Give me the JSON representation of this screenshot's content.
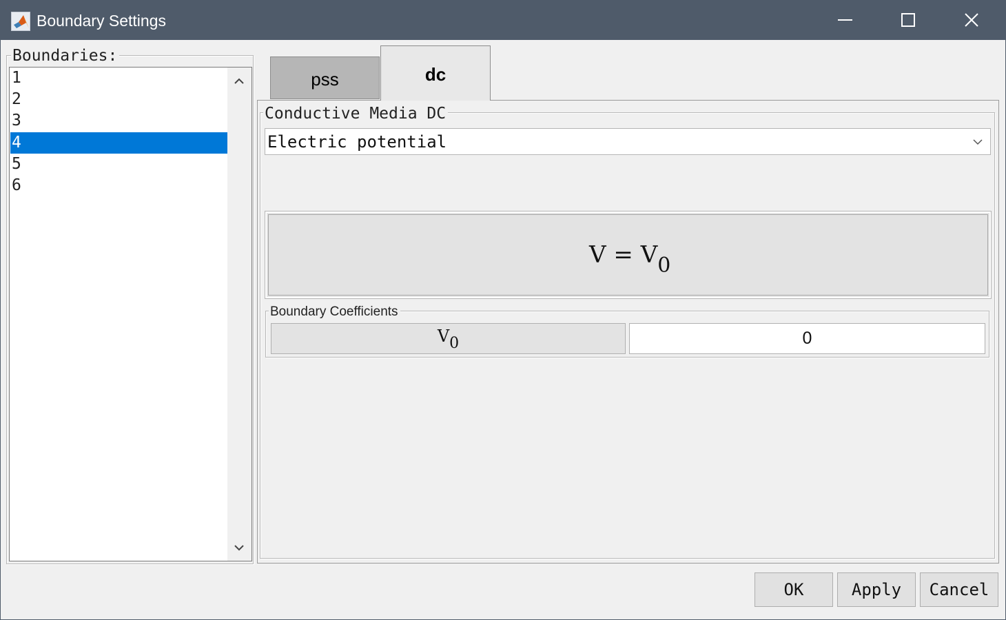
{
  "window": {
    "title": "Boundary Settings",
    "app_icon": "matlab-logo-icon",
    "controls": [
      "minimize-icon",
      "maximize-icon",
      "close-icon"
    ]
  },
  "boundaries": {
    "label": "Boundaries:",
    "items": [
      "1",
      "2",
      "3",
      "4",
      "5",
      "6"
    ],
    "selected": "4"
  },
  "tabs": [
    {
      "label": "pss",
      "active": false
    },
    {
      "label": "dc",
      "active": true
    }
  ],
  "dc_panel": {
    "group_title": "Conductive Media DC",
    "condition_select": {
      "value": "Electric potential"
    },
    "equation": {
      "lhs": "V",
      "op": "=",
      "rhs": "V",
      "rhs_sub": "0"
    },
    "coefficients": {
      "group_title": "Boundary Coefficients",
      "rows": [
        {
          "symbol": "V",
          "symbol_sub": "0",
          "value": "0"
        }
      ]
    }
  },
  "footer": {
    "ok_label": "OK",
    "apply_label": "Apply",
    "cancel_label": "Cancel"
  },
  "colors": {
    "titlebar": "#4f5b6a",
    "selection": "#0078d7",
    "window_bg": "#f0f0f0"
  }
}
